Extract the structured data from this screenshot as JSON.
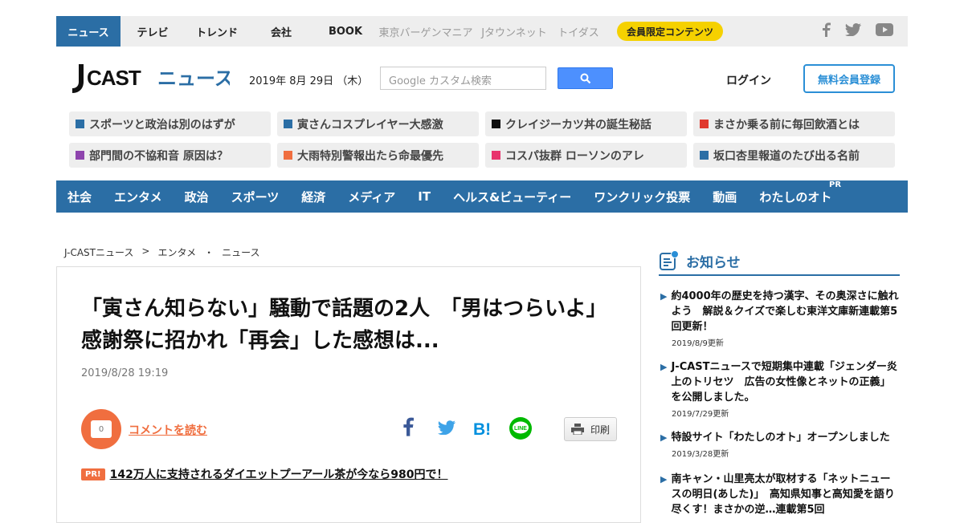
{
  "topnav": {
    "tabs": [
      {
        "label": "ニュース",
        "state": "active"
      },
      {
        "label": "テレビ"
      },
      {
        "label": "トレンド"
      },
      {
        "label": "会社"
      },
      {
        "label": "BOOK"
      },
      {
        "label": "東京バーゲンマニア",
        "style": "muted"
      },
      {
        "label": "Jタウンネット",
        "style": "muted"
      },
      {
        "label": "トイダス",
        "style": "muted"
      }
    ],
    "member_label": "会員限定コンテンツ",
    "social_icons": [
      "facebook-icon",
      "twitter-icon",
      "youtube-icon"
    ]
  },
  "header": {
    "logo_text": "J CAST ニュース",
    "date": "2019年 8月 29日 （木）",
    "search_placeholder": "Google カスタム検索",
    "login_label": "ログイン",
    "register_label": "無料会員登録"
  },
  "topics": [
    {
      "label": "スポーツと政治は別のはずが",
      "color": "#2b6ea5"
    },
    {
      "label": "寅さんコスプレイヤー大感激",
      "color": "#2b6ea5"
    },
    {
      "label": "クレイジーカツ丼の誕生秘話",
      "color": "#111111"
    },
    {
      "label": "まさか乗る前に毎回飲酒とは",
      "color": "#e03a2f"
    },
    {
      "label": "部門間の不協和音 原因は？",
      "color": "#8e44ad"
    },
    {
      "label": "大雨特別警報出たら命最優先",
      "color": "#f06e3f"
    },
    {
      "label": "コスパ抜群 ローソンのアレ",
      "color": "#e8336d"
    },
    {
      "label": "坂口杏里報道のたび出る名前",
      "color": "#2b6ea5"
    }
  ],
  "categories": [
    "社会",
    "エンタメ",
    "政治",
    "スポーツ",
    "経済",
    "メディア",
    "IT",
    "ヘルス&ビューティー",
    "ワンクリック投票",
    "動画",
    "わたしのオト"
  ],
  "category_pr": "PR",
  "breadcrumb": [
    "J-CASTニュース",
    ">",
    "エンタメ",
    "・",
    "ニュース"
  ],
  "article": {
    "headline": "「寅さん知らない」騒動で話題の2人　「男はつらいよ」感謝祭に招かれ「再会」した感想は...",
    "date": "2019/8/28 19:19",
    "comment_count": "0",
    "comment_label": "コメントを読む",
    "share_icons": [
      "facebook-share-icon",
      "twitter-share-icon",
      "hatena-bookmark-icon",
      "line-share-icon"
    ],
    "print_label": "印刷",
    "pr_badge": "PR!",
    "pr_text": "142万人に支持されるダイエットプーアール茶が今なら980円で！"
  },
  "sidebar": {
    "title": "お知らせ",
    "notices": [
      {
        "title": "約4000年の歴史を持つ漢字、その奥深さに触れよう　解説＆クイズで楽しむ東洋文庫新連載第5回更新！",
        "date": "2019/8/9更新"
      },
      {
        "title": "J-CASTニュースで短期集中連載「ジェンダー炎上のトリセツ　広告の女性像とネットの正義」を公開しました。",
        "date": "2019/7/29更新"
      },
      {
        "title": "特設サイト「わたしのオト」オープンしました",
        "date": "2019/3/28更新"
      },
      {
        "title": "南キャン・山里亮太が取材する「ネットニュースの明日(あした)」　高知県知事と高知愛を語り尽くす！まさかの逆…連載第5回",
        "date": ""
      }
    ]
  },
  "colors": {
    "brand_blue": "#2b6ea5",
    "accent_orange": "#f06e3f",
    "member_yellow": "#f5d100"
  }
}
